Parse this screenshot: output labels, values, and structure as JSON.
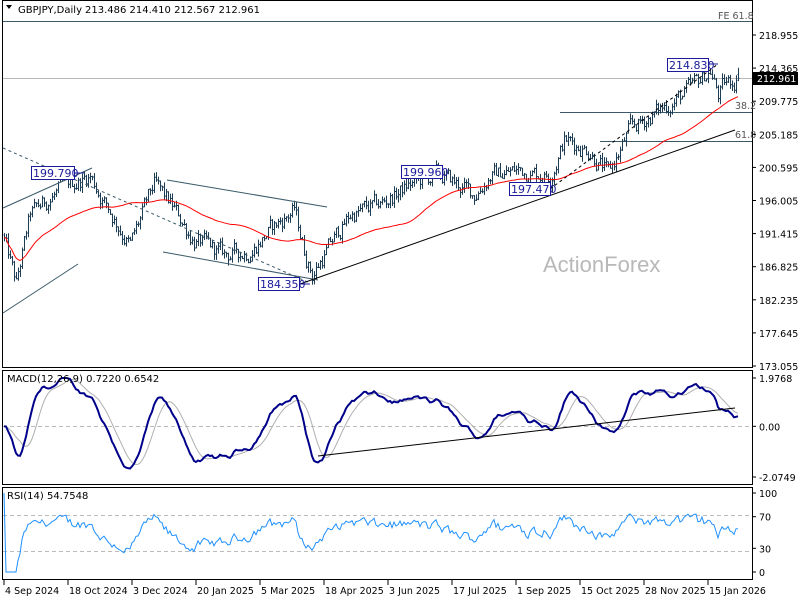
{
  "header": {
    "symbol_label": "GBPJPY,Daily",
    "ohlc": "213.486 214.410 212.567 212.961"
  },
  "watermark": "ActionForex",
  "current_price": "212.961",
  "annotations": {
    "fe618": "FE 61.8",
    "fib382": "38.2",
    "fib618": "61.8",
    "high_1": "199.790",
    "low_1": "184.350",
    "high_2": "199.960",
    "low_2": "197.470",
    "high_3": "214.830"
  },
  "colors": {
    "bars": "#1d3d55",
    "ma": "#ff0000",
    "macd": "#00008b",
    "signal": "#b0b0b0",
    "rsi": "#1e90ff"
  },
  "chart_data": {
    "type": "ohlc",
    "title": "GBPJPY,Daily",
    "ylim": [
      173.055,
      218.955
    ],
    "yticks": [
      "218.955",
      "214.365",
      "209.775",
      "205.185",
      "200.595",
      "196.005",
      "191.415",
      "186.825",
      "182.235",
      "177.645",
      "173.055"
    ],
    "xticks": [
      "4 Sep 2024",
      "18 Oct 2024",
      "3 Dec 2024",
      "20 Jan 2025",
      "5 Mar 2025",
      "18 Apr 2025",
      "3 Jun 2025",
      "17 Jul 2025",
      "1 Sep 2025",
      "15 Oct 2025",
      "28 Nov 2025",
      "15 Jan 2026"
    ],
    "bar_count": 368,
    "close_keypoints": [
      [
        0,
        190.5
      ],
      [
        6,
        184.3
      ],
      [
        13,
        194
      ],
      [
        28,
        197.5
      ],
      [
        43,
        199.5
      ],
      [
        48,
        196.8
      ],
      [
        63,
        189.8
      ],
      [
        75,
        198.2
      ],
      [
        85,
        194.7
      ],
      [
        95,
        190.5
      ],
      [
        110,
        188.4
      ],
      [
        123,
        189
      ],
      [
        133,
        191.9
      ],
      [
        145,
        194.7
      ],
      [
        150,
        189
      ],
      [
        154,
        185.7
      ],
      [
        163,
        189.8
      ],
      [
        173,
        194
      ],
      [
        188,
        195.4
      ],
      [
        203,
        198.2
      ],
      [
        218,
        199.5
      ],
      [
        235,
        196.8
      ],
      [
        243,
        199.5
      ],
      [
        258,
        200.2
      ],
      [
        273,
        199.5
      ],
      [
        280,
        204.4
      ],
      [
        293,
        203
      ],
      [
        302,
        199.5
      ],
      [
        313,
        205.8
      ],
      [
        328,
        208.6
      ],
      [
        343,
        211.3
      ],
      [
        353,
        214.1
      ],
      [
        357,
        210.6
      ],
      [
        360,
        212
      ],
      [
        367,
        212.961
      ]
    ],
    "ma_period": 55,
    "last_bar": {
      "open": 213.486,
      "high": 214.41,
      "low": 212.567,
      "close": 212.961
    },
    "macd": {
      "label": "MACD(12,26,9) 0.7220 0.6542",
      "params": [
        12,
        26,
        9
      ],
      "value": 0.722,
      "signal": 0.6542,
      "ylim": [
        -2.0749,
        1.9768
      ],
      "yticks": [
        "1.9768",
        "0.00",
        "-2.0749"
      ]
    },
    "rsi": {
      "label": "RSI(14) 54.7548",
      "period": 14,
      "value": 54.7548,
      "ylim": [
        0,
        100
      ],
      "yticks": [
        "100",
        "70",
        "30",
        "0"
      ],
      "levels": [
        70,
        30
      ]
    }
  }
}
